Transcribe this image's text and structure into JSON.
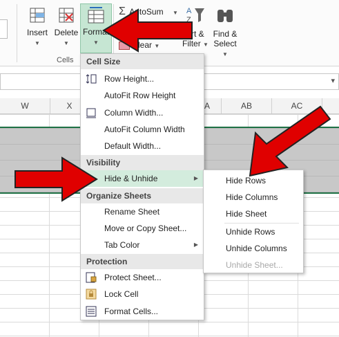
{
  "ribbon": {
    "insert_label": "Insert",
    "delete_label": "Delete",
    "format_label": "Format",
    "autosum_label": "AutoSum",
    "clear_label": "Clear",
    "sort_label_1": "ort &",
    "sort_label_2": "Filter",
    "find_label_1": "Find &",
    "find_label_2": "Select",
    "group_cells": "Cells"
  },
  "columns": [
    "W",
    "X",
    "A",
    "AB",
    "AC"
  ],
  "menu": {
    "sections": {
      "cell_size": "Cell Size",
      "visibility": "Visibility",
      "organize": "Organize Sheets",
      "protection": "Protection"
    },
    "items": {
      "row_height": "Row Height...",
      "autofit_row": "AutoFit Row Height",
      "column_width": "Column Width...",
      "autofit_col": "AutoFit Column Width",
      "default_width": "Default Width...",
      "hide_unhide": "Hide & Unhide",
      "rename": "Rename Sheet",
      "move_copy": "Move or Copy Sheet...",
      "tab_color": "Tab Color",
      "protect": "Protect Sheet...",
      "lock": "Lock Cell",
      "format_cells": "Format Cells..."
    }
  },
  "submenu": {
    "hide_rows": "Hide Rows",
    "hide_columns": "Hide Columns",
    "hide_sheet": "Hide Sheet",
    "unhide_rows": "Unhide Rows",
    "unhide_columns": "Unhide Columns",
    "unhide_sheet": "Unhide Sheet..."
  },
  "colors": {
    "accent_green": "#1e7145",
    "highlight": "#d3ecdd",
    "arrow_red": "#e00000"
  }
}
